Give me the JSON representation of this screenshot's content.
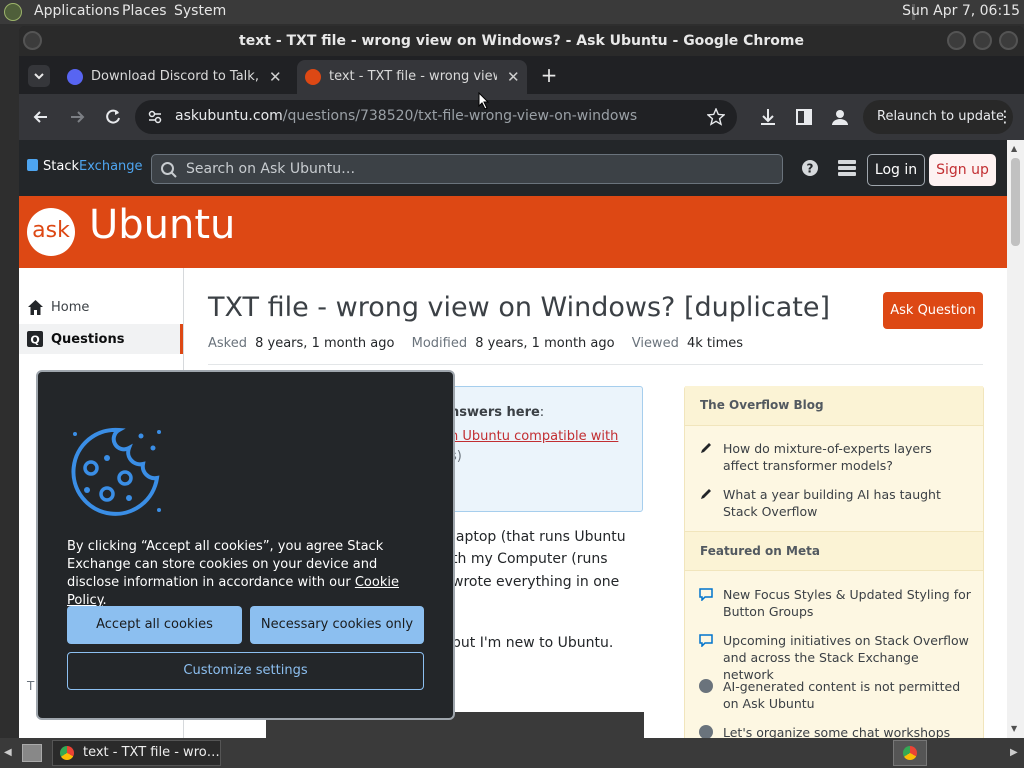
{
  "desktop": {
    "menus": [
      "Applications",
      "Places",
      "System"
    ],
    "clock": "Sun Apr  7, 06:15"
  },
  "window": {
    "title": "text - TXT file - wrong view on Windows? - Ask Ubuntu - Google Chrome"
  },
  "tabs": [
    {
      "label": "Download Discord to Talk, Ch",
      "favicon": "discord-icon",
      "active": false
    },
    {
      "label": "text - TXT file - wrong view o",
      "favicon": "askubuntu-icon",
      "active": true
    }
  ],
  "toolbar": {
    "url_host": "askubuntu.com",
    "url_path": "/questions/738520/txt-file-wrong-view-on-windows",
    "relaunch_label": "Relaunch to update"
  },
  "site": {
    "network_name_a": "Stack",
    "network_name_b": "Exchange",
    "search_placeholder": "Search on Ask Ubuntu…",
    "login_label": "Log in",
    "signup_label": "Sign up",
    "brand_badge": "ask",
    "brand_name": "Ubuntu"
  },
  "sidebar": {
    "items": [
      {
        "label": "Home"
      },
      {
        "label": "Questions"
      }
    ],
    "partial_label": "T"
  },
  "question": {
    "title": "TXT file - wrong view on Windows? [duplicate]",
    "ask_label": "Ask Question",
    "asked_label": "Asked",
    "asked_value": "8 years, 1 month ago",
    "modified_label": "Modified",
    "modified_value": "8 years, 1 month ago",
    "viewed_label": "Viewed",
    "viewed_value": "4k times",
    "dup_heading": "nswers here",
    "dup_heading_colon": ":",
    "dup_link": "n Ubuntu compatible with",
    "dup_tail": "s)",
    "body_1": "laptop (that runs Ubuntu",
    "body_2": "th my Computer (runs",
    "body_3": "wrote everything in one",
    "body_4": "but I'm new to Ubuntu."
  },
  "aside": {
    "blog_heading": "The Overflow Blog",
    "blog_items": [
      "How do mixture-of-experts layers affect transformer models?",
      "What a year building AI has taught Stack Overflow"
    ],
    "meta_heading": "Featured on Meta",
    "meta_items": [
      "New Focus Styles & Updated Styling for Button Groups",
      "Upcoming initiatives on Stack Overflow and across the Stack Exchange network",
      "AI-generated content is not permitted on Ask Ubuntu",
      "Let's organize some chat workshops"
    ]
  },
  "cookie": {
    "text_before_link": "By clicking “Accept all cookies”, you agree Stack Exchange can store cookies on your device and disclose information in accordance with our ",
    "link_label": "Cookie Policy",
    "text_after_link": ".",
    "accept_label": "Accept all cookies",
    "necessary_label": "Necessary cookies only",
    "customize_label": "Customize settings"
  },
  "taskbar": {
    "task_label": "text - TXT file - wro…"
  },
  "colors": {
    "ubuntu_orange": "#dd4814",
    "se_header": "#232629",
    "cookie_button": "#8cbff0",
    "chrome_frame": "#35363a"
  }
}
